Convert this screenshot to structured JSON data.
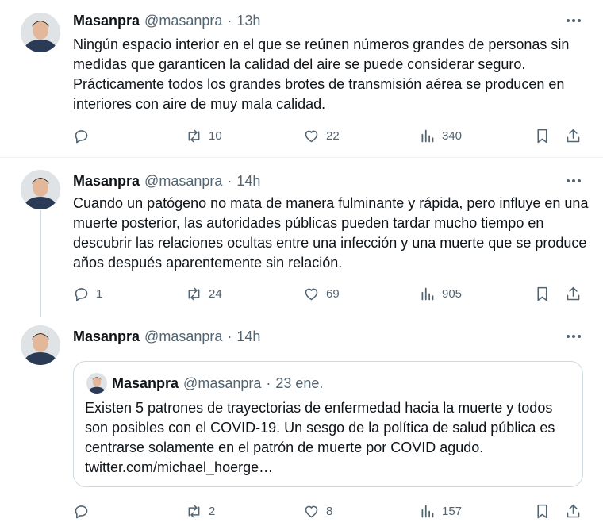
{
  "tweets": [
    {
      "name": "Masanpra",
      "handle": "@masanpra",
      "separator": "·",
      "time": "13h",
      "text": "Ningún espacio interior en el que se reúnen números grandes de personas sin medidas que garanticen la calidad del aire se puede considerar seguro. Prácticamente todos los grandes brotes de transmisión aérea se producen en interiores con aire de muy mala calidad.",
      "replies": "",
      "retweets": "10",
      "likes": "22",
      "views": "340"
    },
    {
      "name": "Masanpra",
      "handle": "@masanpra",
      "separator": "·",
      "time": "14h",
      "text": "Cuando un patógeno no mata de manera fulminante y rápida, pero influye en una muerte posterior, las autoridades públicas pueden tardar mucho tiempo en descubrir las relaciones ocultas entre una infección y una muerte que se produce años después aparentemente sin relación.",
      "replies": "1",
      "retweets": "24",
      "likes": "69",
      "views": "905"
    },
    {
      "name": "Masanpra",
      "handle": "@masanpra",
      "separator": "·",
      "time": "14h",
      "replies": "",
      "retweets": "2",
      "likes": "8",
      "views": "157",
      "quote": {
        "name": "Masanpra",
        "handle": "@masanpra",
        "separator": "·",
        "time": "23 ene.",
        "text": "Existen 5 patrones de trayectorias de enfermedad hacia la muerte y todos son posibles con el COVID-19. Un sesgo de la política de salud pública es centrarse solamente en el patrón de muerte por COVID agudo. twitter.com/michael_hoerge…"
      }
    }
  ],
  "icons": {
    "more": "more-horizontal-icon",
    "reply": "reply-bubble-icon",
    "retweet": "retweet-arrows-icon",
    "like": "heart-icon",
    "views": "views-bar-chart-icon",
    "bookmark": "bookmark-icon",
    "share": "share-upload-icon"
  },
  "colors": {
    "text": "#0f1419",
    "secondary": "#536471",
    "border": "#cfd9de",
    "divider": "#eff3f4"
  }
}
